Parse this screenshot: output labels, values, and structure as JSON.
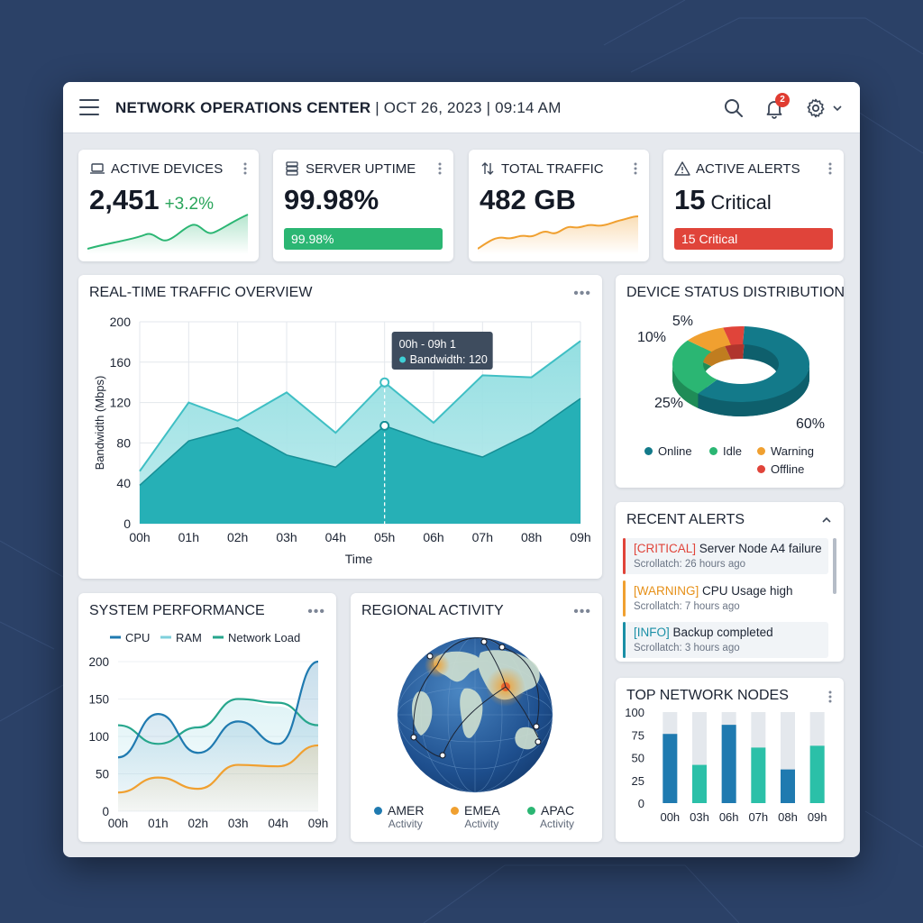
{
  "header": {
    "title": "NETWORK OPERATIONS CENTER",
    "datetime": "| OCT 26, 2023 | 09:14 AM",
    "notification_count": "2"
  },
  "kpis": {
    "devices": {
      "title": "ACTIVE DEVICES",
      "value": "2,451",
      "delta": "+3.2%"
    },
    "uptime": {
      "title": "SERVER UPTIME",
      "value": "99.98%",
      "bar_label": "99.98%",
      "level": 0.9998
    },
    "traffic": {
      "title": "TOTAL TRAFFIC",
      "value": "482 GB"
    },
    "alerts": {
      "title": "ACTIVE ALERTS",
      "value": "15",
      "sub": "Critical",
      "bar_label": "15 Critical"
    }
  },
  "realtime": {
    "title": "REAL-TIME TRAFFIC OVERVIEW",
    "tooltip_title": "00h - 09h 1",
    "tooltip_value": "Bandwidth: 120"
  },
  "device_status": {
    "title": "DEVICE STATUS DISTRIBUTION",
    "labels": {
      "offline": "5%",
      "warning": "10%",
      "idle": "25%",
      "online": "60%"
    },
    "legend": {
      "online": "Online",
      "idle": "Idle",
      "warning": "Warning",
      "offline": "Offline"
    }
  },
  "recent_alerts": {
    "title": "RECENT ALERTS",
    "items": [
      {
        "tag": "[CRITICAL]",
        "text": "Server Node A4 failure",
        "meta": "Scrollatch: 26 hours ago"
      },
      {
        "tag": "[WARNING]",
        "text": "CPU Usage high",
        "meta": "Scrollatch: 7 hours ago"
      },
      {
        "tag": "[INFO]",
        "text": "Backup completed",
        "meta": "Scrollatch: 3 hours ago"
      }
    ]
  },
  "system_perf": {
    "title": "SYSTEM PERFORMANCE"
  },
  "regional": {
    "title": "REGIONAL ACTIVITY",
    "legend": [
      {
        "name": "AMER",
        "sub": "Activity"
      },
      {
        "name": "EMEA",
        "sub": "Activity"
      },
      {
        "name": "APAC",
        "sub": "Activity"
      }
    ]
  },
  "top_nodes": {
    "title": "TOP NETWORK NODES"
  },
  "colors": {
    "teal": "#1aa8b0",
    "teal_light": "#8fdde0",
    "green": "#2bb673",
    "orange": "#f0a030",
    "red": "#e0443a",
    "blue": "#1f7ab0",
    "dark_teal": "#137a8a"
  },
  "chart_data": [
    {
      "type": "area",
      "title": "REAL-TIME TRAFFIC OVERVIEW",
      "xlabel": "Time",
      "ylabel": "Bandwidth (Mbps)",
      "categories": [
        "00h",
        "01h",
        "02h",
        "03h",
        "04h",
        "05h",
        "06h",
        "07h",
        "08h",
        "09h"
      ],
      "ylim": [
        0,
        200
      ],
      "yticks": [
        0,
        40,
        80,
        120,
        160,
        200
      ],
      "grid": true,
      "series": [
        {
          "values": [
            52,
            120,
            102,
            130,
            90,
            140,
            100,
            147,
            145,
            181
          ]
        },
        {
          "values": [
            38,
            82,
            95,
            68,
            56,
            97,
            80,
            66,
            90,
            124
          ]
        }
      ]
    },
    {
      "type": "pie",
      "title": "DEVICE STATUS DISTRIBUTION",
      "categories": [
        "Online",
        "Idle",
        "Warning",
        "Offline"
      ],
      "values": [
        60,
        25,
        10,
        5
      ],
      "legend": "bottom"
    },
    {
      "type": "line",
      "title": "SYSTEM PERFORMANCE",
      "categories": [
        "00h",
        "01h",
        "02h",
        "03h",
        "04h",
        "09h"
      ],
      "ylim": [
        0,
        200
      ],
      "yticks": [
        0,
        50,
        100,
        150,
        200
      ],
      "legend": "top",
      "series": [
        {
          "name": "CPU",
          "values": [
            72,
            130,
            78,
            120,
            90,
            200
          ]
        },
        {
          "name": "RAM",
          "values": [
            115,
            88,
            115,
            148,
            140,
            115
          ]
        },
        {
          "name": "Network Load",
          "values": [
            25,
            45,
            30,
            62,
            60,
            88
          ]
        }
      ]
    },
    {
      "type": "bar",
      "title": "TOP NETWORK NODES",
      "categories": [
        "00h",
        "03h",
        "06h",
        "07h",
        "08h",
        "09h"
      ],
      "ylim": [
        0,
        100
      ],
      "yticks": [
        0,
        25,
        50,
        75,
        100
      ],
      "values": [
        76,
        42,
        86,
        61,
        37,
        63
      ]
    }
  ]
}
